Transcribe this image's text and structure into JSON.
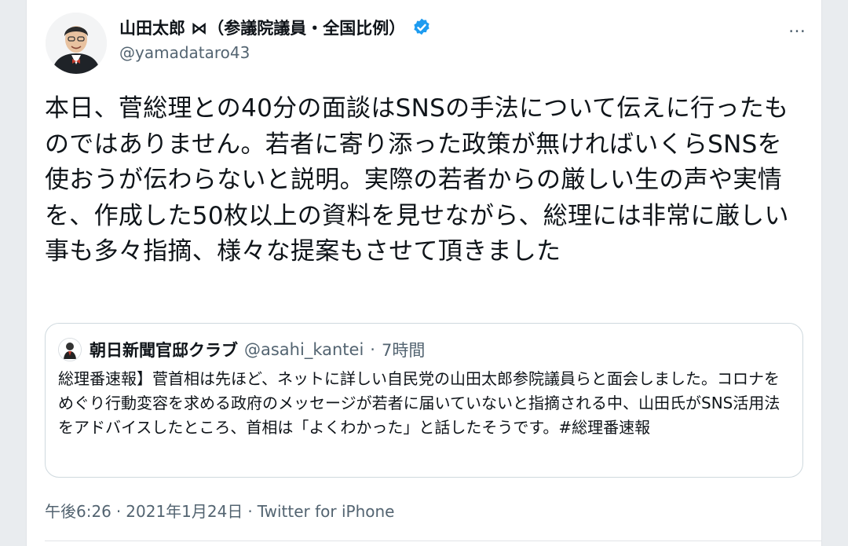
{
  "author": {
    "name": "山田太郎 ⋈（参議院議員・全国比例）",
    "handle": "@yamadataro43",
    "verified": true
  },
  "more_icon": "…",
  "tweet": {
    "text": "本日、菅総理との40分の面談はSNSの手法について伝えに行ったものではありません。若者に寄り添った政策が無ければいくらSNSを使おうが伝わらないと説明。実際の若者からの厳しい生の声や実情を、作成した50枚以上の資料を見せながら、総理には非常に厳しい事も多々指摘、様々な提案もさせて頂きました"
  },
  "quoted_tweet": {
    "name": "朝日新聞官邸クラブ",
    "handle": "@asahi_kantei",
    "separator": "·",
    "time": "7時間",
    "text": "総理番速報】菅首相は先ほど、ネットに詳しい自民党の山田太郎参院議員らと面会しました。コロナをめぐり行動変容を求める政府のメッセージが若者に届いていないと指摘される中、山田氏がSNS活用法をアドバイスしたところ、首相は「よくわかった」と話したそうです。#総理番速報"
  },
  "meta": {
    "time": "午後6:26",
    "date": "2021年1月24日",
    "separator": "·",
    "source": "Twitter for iPhone"
  },
  "colors": {
    "verified": "#1d9bf0",
    "secondary_text": "#536471",
    "border": "#cfd9de"
  }
}
